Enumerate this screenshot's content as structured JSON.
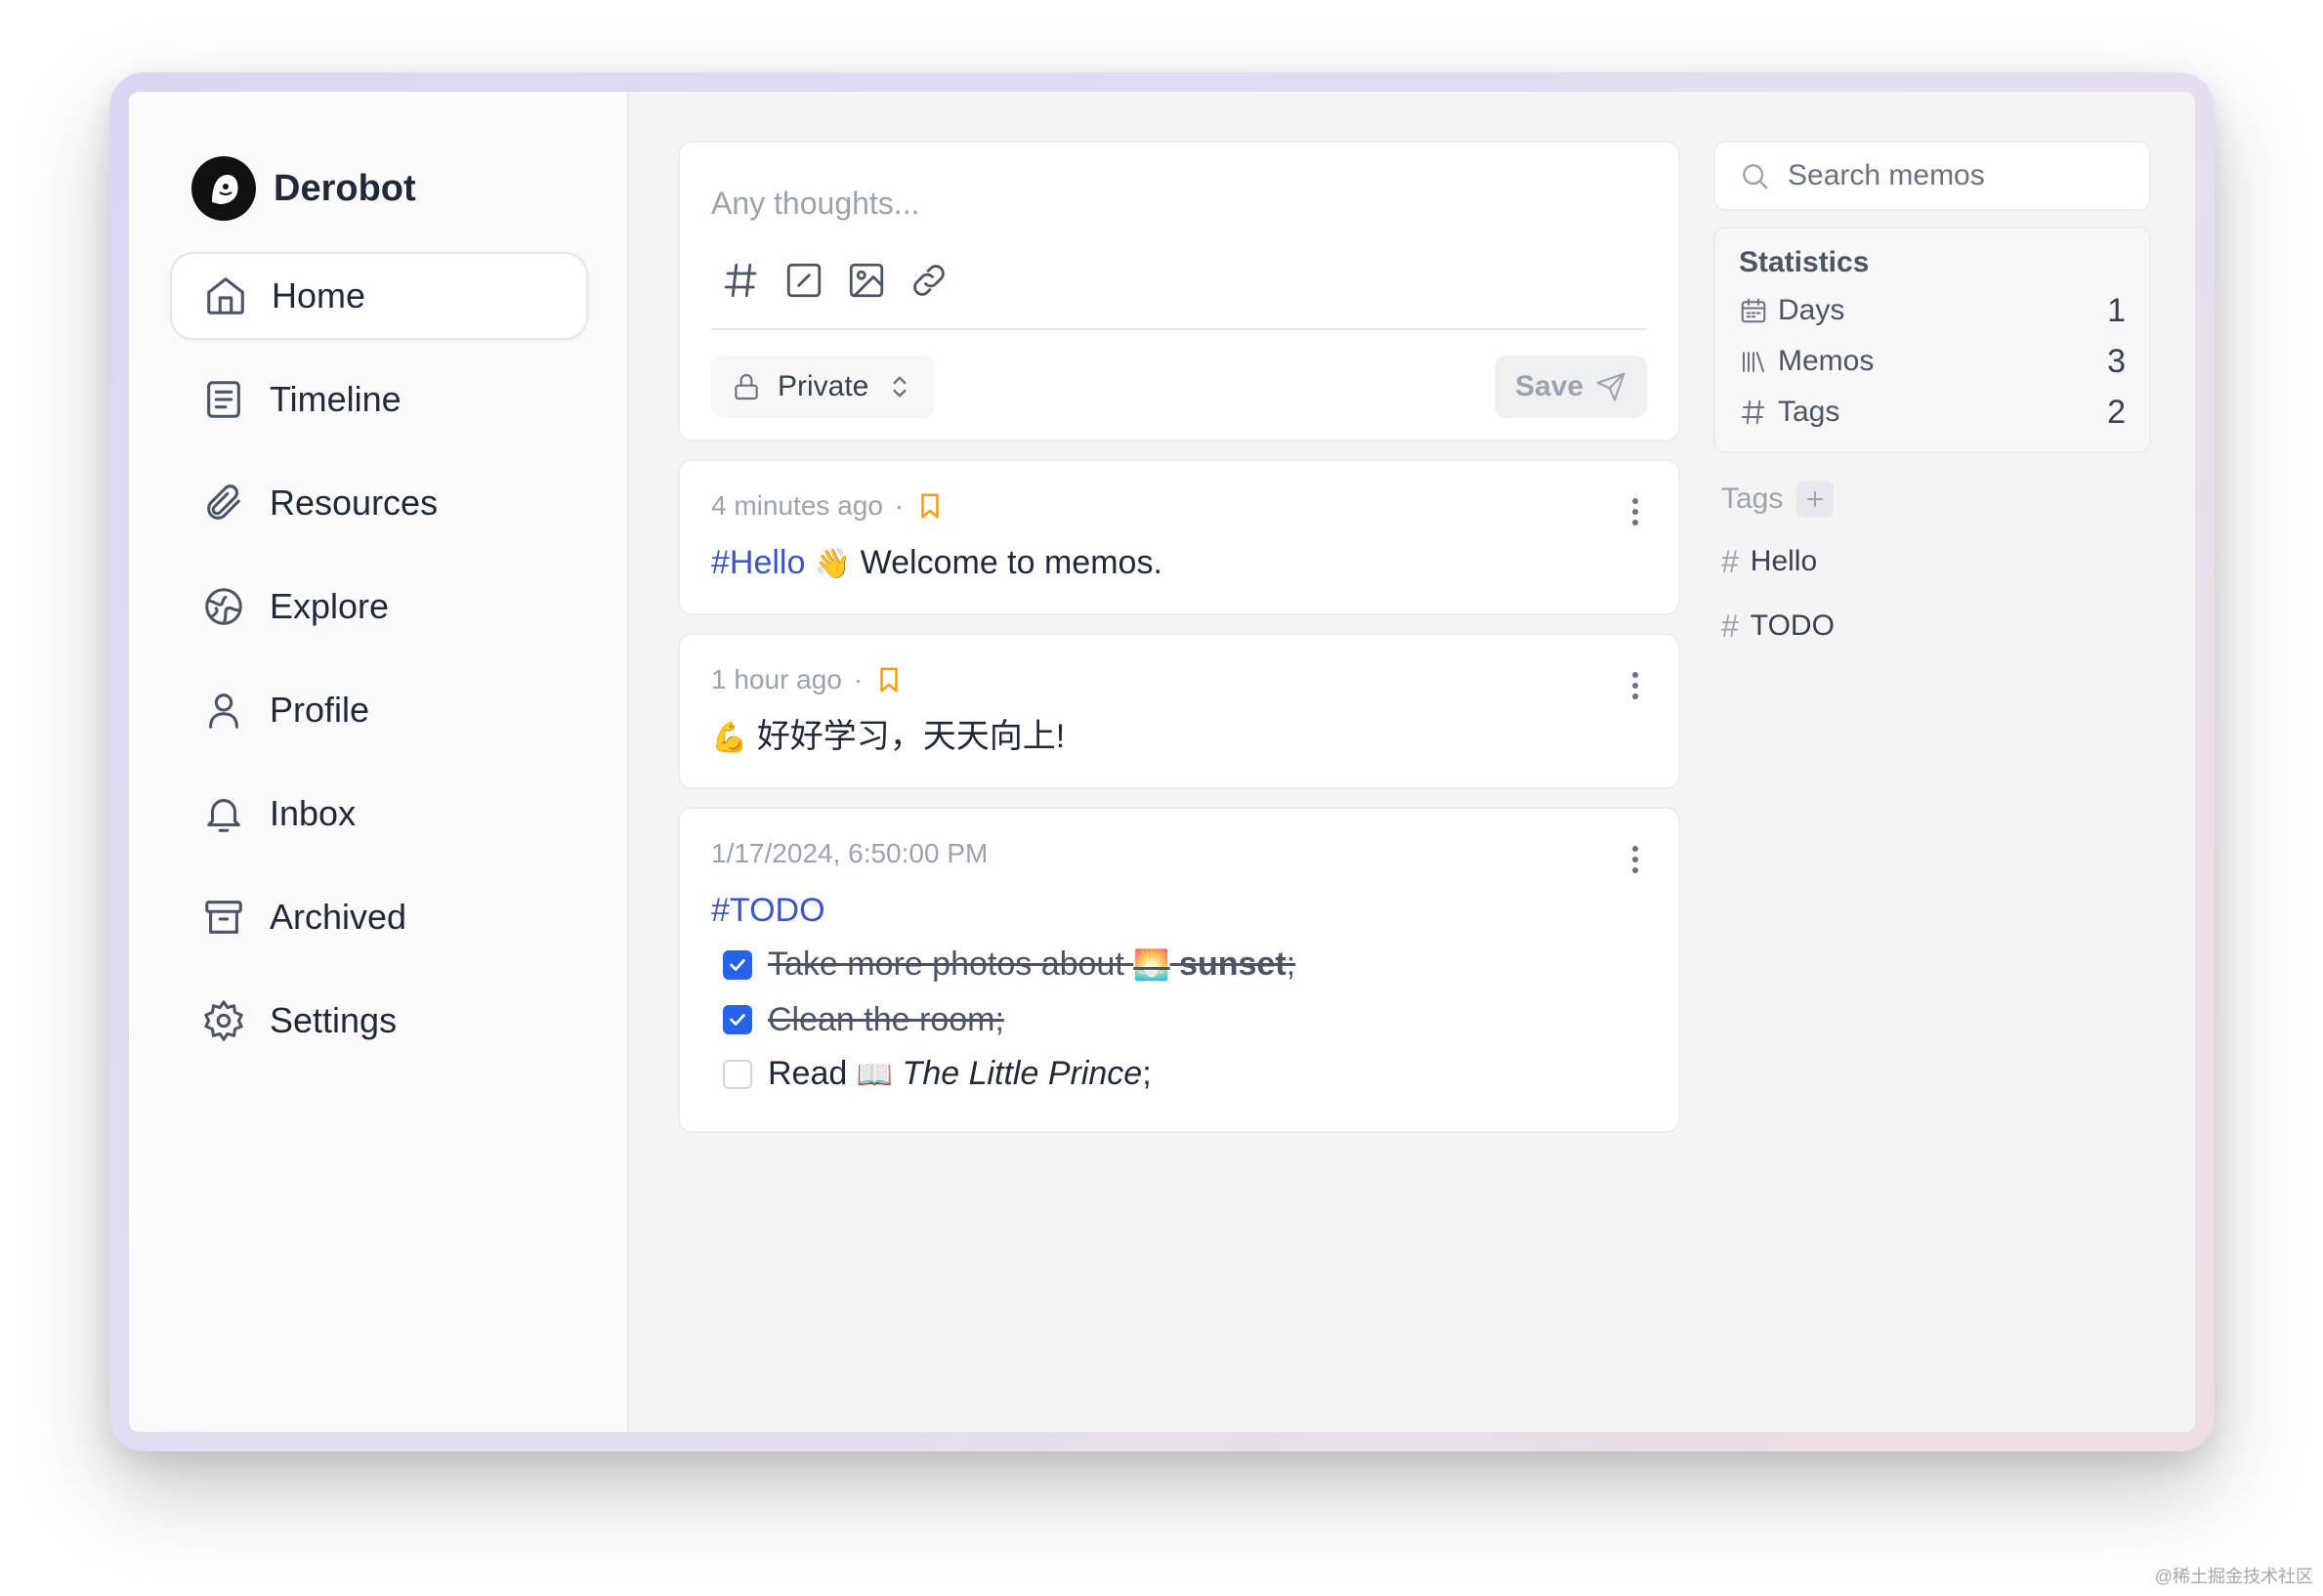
{
  "app": {
    "name": "Derobot"
  },
  "nav": [
    {
      "label": "Home",
      "icon": "home-icon",
      "active": true
    },
    {
      "label": "Timeline",
      "icon": "timeline-icon"
    },
    {
      "label": "Resources",
      "icon": "paperclip-icon"
    },
    {
      "label": "Explore",
      "icon": "globe-icon"
    },
    {
      "label": "Profile",
      "icon": "user-icon"
    },
    {
      "label": "Inbox",
      "icon": "bell-icon"
    },
    {
      "label": "Archived",
      "icon": "archive-icon"
    },
    {
      "label": "Settings",
      "icon": "gear-icon"
    }
  ],
  "editor": {
    "placeholder": "Any thoughts...",
    "visibility": "Private",
    "save_label": "Save"
  },
  "memos": [
    {
      "time": "4 minutes ago",
      "tag": "#Hello",
      "emoji": "👋",
      "text": "Welcome to memos."
    },
    {
      "time": "1 hour ago",
      "emoji": "💪",
      "text": "好好学习，天天向上!"
    },
    {
      "time": "1/17/2024, 6:50:00 PM",
      "tag": "#TODO",
      "tasks": [
        {
          "checked": true,
          "text_before": "Take more photos about",
          "emoji": "🌅",
          "bold": "sunset",
          "suffix": ";"
        },
        {
          "checked": true,
          "text": "Clean the room;"
        },
        {
          "checked": false,
          "text_before": "Read",
          "emoji": "📖",
          "italic": "The Little Prince",
          "suffix": ";"
        }
      ]
    }
  ],
  "search": {
    "placeholder": "Search memos"
  },
  "statistics": {
    "title": "Statistics",
    "rows": [
      {
        "label": "Days",
        "value": "1",
        "icon": "calendar-icon"
      },
      {
        "label": "Memos",
        "value": "3",
        "icon": "library-icon"
      },
      {
        "label": "Tags",
        "value": "2",
        "icon": "hash-icon"
      }
    ]
  },
  "tags": {
    "title": "Tags",
    "items": [
      "Hello",
      "TODO"
    ]
  },
  "colors": {
    "accent": "#3b55c6",
    "checkbox": "#2563eb",
    "bookmark": "#f59e0b"
  },
  "watermark": "@稀土掘金技术社区"
}
